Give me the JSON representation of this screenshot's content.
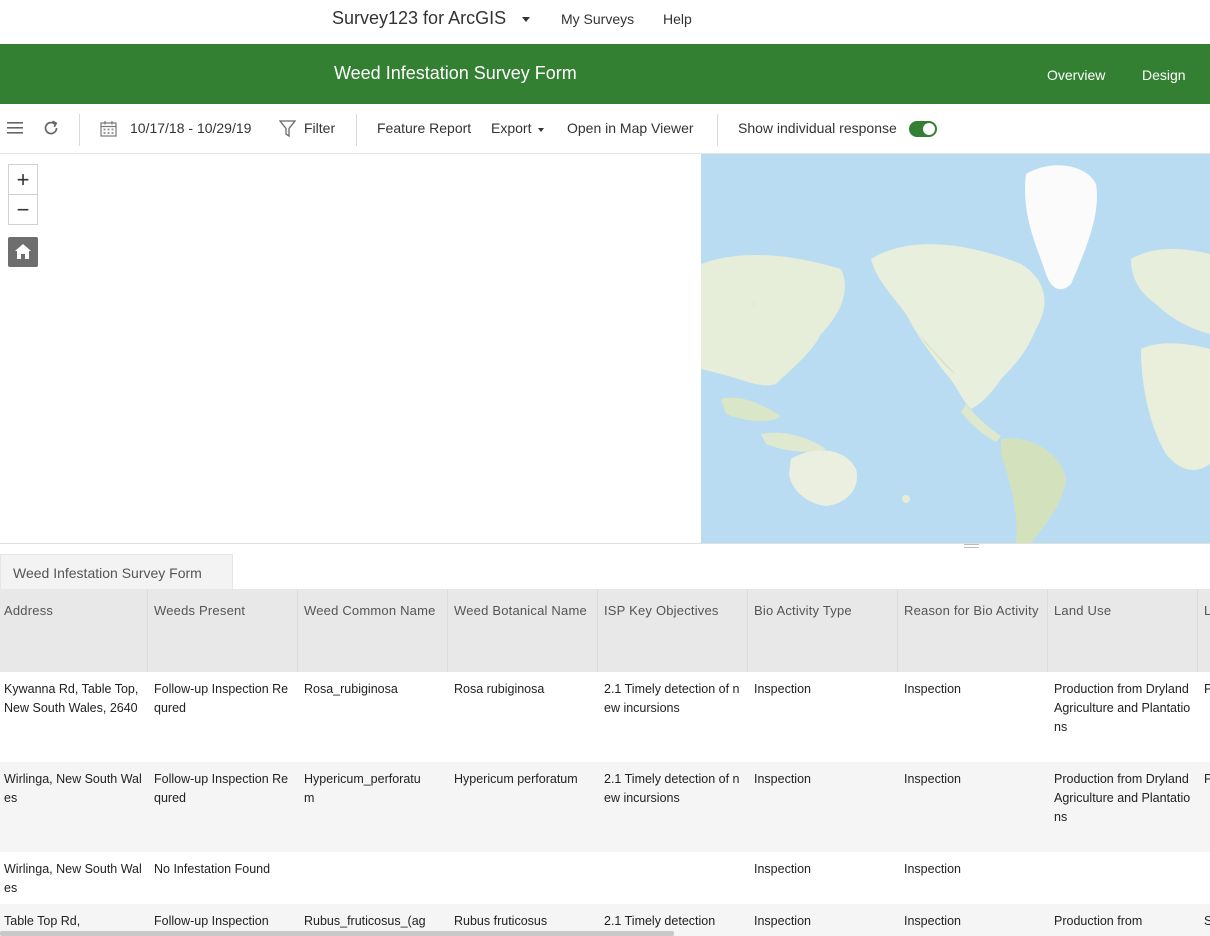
{
  "topnav": {
    "app_title": "Survey123 for ArcGIS",
    "links": [
      "My Surveys",
      "Help"
    ]
  },
  "header": {
    "survey_title": "Weed Infestation Survey Form",
    "tabs": [
      "Overview",
      "Design"
    ],
    "color": "#338033"
  },
  "toolbar": {
    "date_range": "10/17/18 - 10/29/19",
    "filter": "Filter",
    "feature_report": "Feature Report",
    "export": "Export",
    "open_map_viewer": "Open in Map Viewer",
    "show_individual": "Show individual response",
    "show_individual_on": true
  },
  "map": {
    "zoom_in": "+",
    "zoom_out": "−"
  },
  "table": {
    "tab_label": "Weed Infestation Survey Form",
    "columns": [
      "Address",
      "Weeds Present",
      "Weed Common Name",
      "Weed Botanical Name",
      "ISP Key Objectives",
      "Bio Activity Type",
      "Reason for Bio Activity",
      "Land Use",
      "L"
    ],
    "rows": [
      [
        "Kywanna Rd, Table Top, New South Wales, 2640",
        "Follow-up Inspection Requred",
        "Rosa_rubiginosa",
        "Rosa rubiginosa",
        "2.1 Timely detection of new incursions",
        "Inspection",
        "Inspection",
        "Production from Dryland Agriculture and Plantations",
        "P"
      ],
      [
        "Wirlinga, New South Wales",
        "Follow-up Inspection Requred",
        "Hypericum_perforatu\nm",
        "Hypericum perforatum",
        "2.1 Timely detection of new incursions",
        "Inspection",
        "Inspection",
        "Production from Dryland Agriculture and Plantations",
        "P"
      ],
      [
        "Wirlinga, New South Wales",
        "No Infestation Found",
        "",
        "",
        "",
        "Inspection",
        "Inspection",
        "",
        ""
      ],
      [
        "Table Top Rd,",
        "Follow-up Inspection",
        "Rubus_fruticosus_(ag",
        "Rubus fruticosus",
        "2.1 Timely detection",
        "Inspection",
        "Inspection",
        "Production from",
        "S"
      ]
    ]
  }
}
